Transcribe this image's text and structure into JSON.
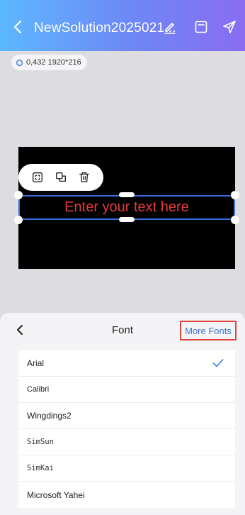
{
  "header": {
    "title": "NewSolution2025021...",
    "icons": [
      "back-icon",
      "edit-icon",
      "save-icon",
      "send-icon"
    ]
  },
  "canvas": {
    "coord_label": "0,432 1920*216",
    "text_placeholder": "Enter your text here",
    "text_color": "#e53a3a",
    "canvas_color": "#000000",
    "toolbar_icons": [
      "crop-frame-icon",
      "duplicate-icon",
      "delete-icon"
    ]
  },
  "font_panel": {
    "title": "Font",
    "more_fonts_label": "More Fonts",
    "items": [
      {
        "label": "Arial",
        "selected": true
      },
      {
        "label": "Calibri",
        "selected": false
      },
      {
        "label": "Wingdings2",
        "selected": false
      },
      {
        "label": "SimSun",
        "selected": false
      },
      {
        "label": "SimKai",
        "selected": false
      },
      {
        "label": "Microsoft Yahei",
        "selected": false
      }
    ]
  },
  "colors": {
    "header_gradient_start": "#5cb8ff",
    "header_gradient_end": "#8a6cf2",
    "selection_border": "#3d6fe0",
    "highlight_border": "#e0453c",
    "accent_text": "#3e73d8"
  }
}
